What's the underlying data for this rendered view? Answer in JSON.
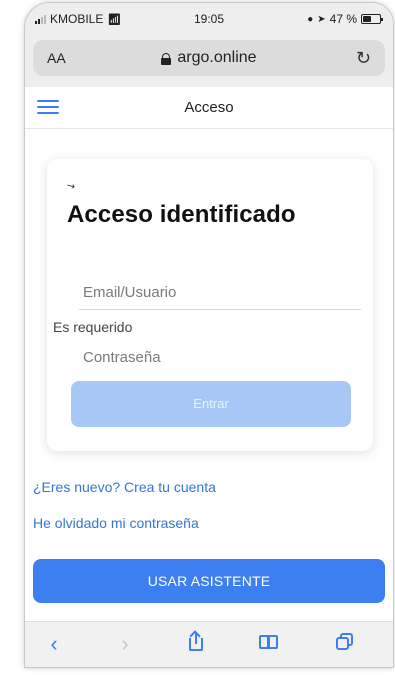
{
  "status_bar": {
    "carrier": "KMOBILE",
    "time": "19:05",
    "battery": "47 %",
    "battery_level": 0.47
  },
  "browser": {
    "text_size_label": "AA",
    "url": "argo.online"
  },
  "header": {
    "title": "Acceso"
  },
  "login_card": {
    "heading": "Acceso identificado",
    "email_placeholder": "Email/Usuario",
    "required_message": "Es requerido",
    "password_placeholder": "Contraseña",
    "submit_label": "Entrar"
  },
  "links": {
    "register": "¿Eres nuevo? Crea tu cuenta",
    "forgot_password": "He olvidado mi contraseña"
  },
  "assistant_button": "USAR ASISTENTE",
  "colors": {
    "accent": "#3b7ff0",
    "button_disabled": "#a7c7f7",
    "link": "#3575d6"
  },
  "icons": {
    "toolbar": [
      "back-icon",
      "forward-icon",
      "share-icon",
      "bookmarks-icon",
      "tabs-icon"
    ]
  }
}
